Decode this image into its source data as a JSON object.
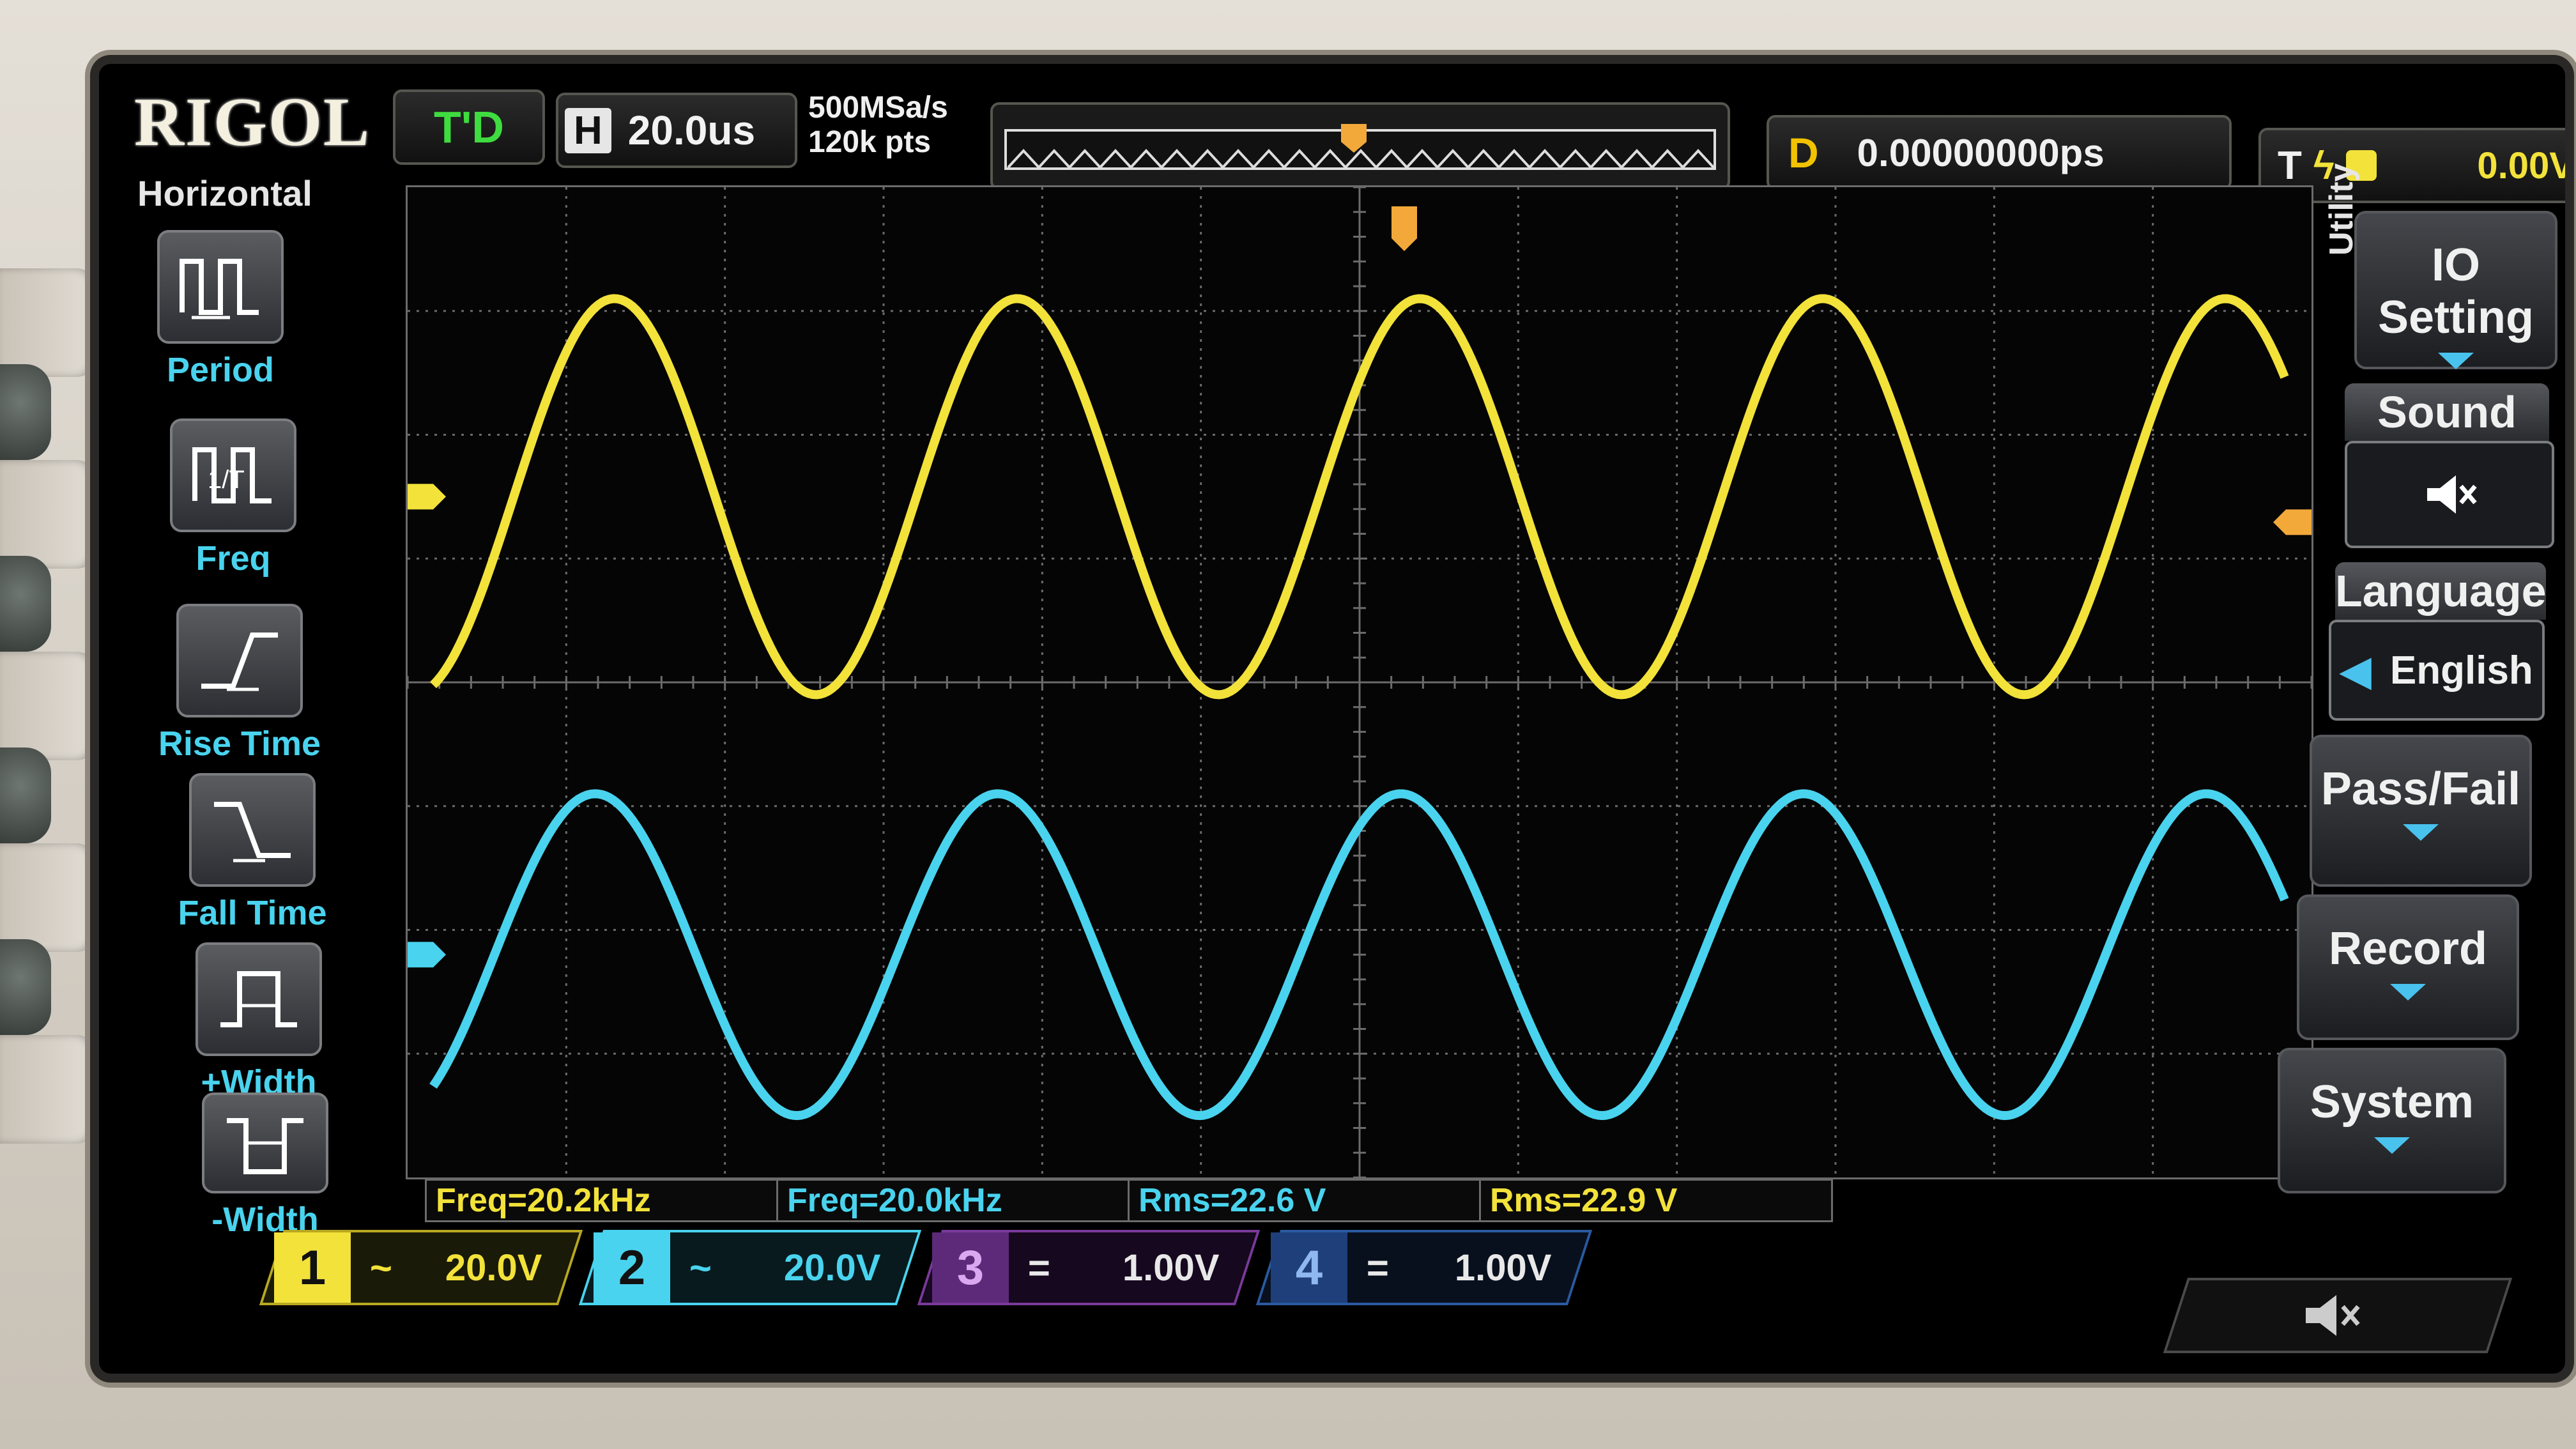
{
  "brand": "RIGOL",
  "status": {
    "run_state": "T'D"
  },
  "horizontal": {
    "tag": "H",
    "timebase": "20.0us",
    "sample_rate": "500MSa/s",
    "memory_depth": "120k pts"
  },
  "delay": {
    "tag": "D",
    "value": "0.00000000ps"
  },
  "trigger": {
    "tag": "T",
    "level": "0.00V"
  },
  "measure_menu": {
    "title": "Horizontal",
    "items": [
      {
        "label": "Period",
        "icon": "period-icon"
      },
      {
        "label": "Freq",
        "icon": "frequency-icon"
      },
      {
        "label": "Rise Time",
        "icon": "rise-time-icon"
      },
      {
        "label": "Fall Time",
        "icon": "fall-time-icon"
      },
      {
        "label": "+Width",
        "icon": "positive-width-icon"
      },
      {
        "label": "-Width",
        "icon": "negative-width-icon"
      }
    ]
  },
  "utility_menu": {
    "tab": "Utility",
    "io_setting": "IO Setting",
    "sound": "Sound",
    "language": "Language",
    "language_value": "English",
    "pass_fail": "Pass/Fail",
    "record": "Record",
    "system": "System"
  },
  "measurements": [
    {
      "text": "Freq=20.2kHz",
      "color": "#f2e23a"
    },
    {
      "text": "Freq=20.0kHz",
      "color": "#49d3ee"
    },
    {
      "text": "Rms=22.6 V",
      "color": "#49d3ee"
    },
    {
      "text": "Rms=22.9 V",
      "color": "#f2e23a"
    }
  ],
  "channels": [
    {
      "number": "1",
      "coupling": "~",
      "scale": "20.0V",
      "color": "#f2e23a"
    },
    {
      "number": "2",
      "coupling": "~",
      "scale": "20.0V",
      "color": "#49d3ee"
    },
    {
      "number": "3",
      "coupling": "=",
      "scale": "1.00V",
      "color": "#b85ad9"
    },
    {
      "number": "4",
      "coupling": "=",
      "scale": "1.00V",
      "color": "#3a7df2"
    }
  ],
  "colors": {
    "ch1": "#f2e23a",
    "ch2": "#49d3ee",
    "grid": "#6b6b6b",
    "screen_bg": "#050505"
  },
  "waveforms": [
    {
      "channel": "1",
      "shape": "sine",
      "cycles_on_screen": 4.6,
      "amplitude_divisions": 3.2,
      "offset_divisions": 1.5
    },
    {
      "channel": "2",
      "shape": "sine",
      "cycles_on_screen": 4.6,
      "amplitude_divisions": 2.6,
      "offset_divisions": -2.2
    }
  ]
}
